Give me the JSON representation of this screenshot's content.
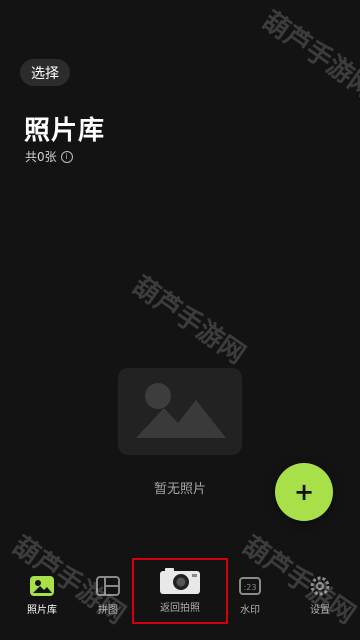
{
  "header": {
    "select_label": "选择"
  },
  "library": {
    "title": "照片库",
    "count_text": "共0张",
    "info_icon": "info-icon"
  },
  "empty_state": {
    "message": "暂无照片",
    "icon": "image-placeholder-icon"
  },
  "fab": {
    "label": "+",
    "icon": "plus-icon",
    "color": "#a7e048"
  },
  "tabs": [
    {
      "label": "照片库",
      "icon": "photo-library-icon",
      "active": true
    },
    {
      "label": "拼图",
      "icon": "puzzle-icon",
      "active": false
    },
    {
      "label": "返回拍照",
      "icon": "camera-icon",
      "active": false
    },
    {
      "label": "水印",
      "icon": "watermark-icon",
      "active": false
    },
    {
      "label": "设置",
      "icon": "gear-icon",
      "active": false
    }
  ],
  "overlay_watermark": "葫芦手游网",
  "colors": {
    "accent": "#a7e048",
    "highlight_border": "#d4000b",
    "background": "#131313"
  }
}
